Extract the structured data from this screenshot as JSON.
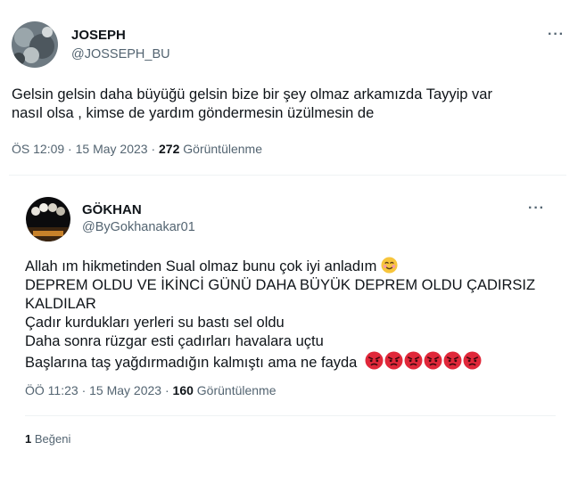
{
  "tweet1": {
    "display_name": "JOSEPH",
    "handle": "@JOSSEPH_BU",
    "more": "···",
    "text_line1": "Gelsin gelsin daha büyüğü gelsin bize bir şey olmaz arkamızda Tayyip var",
    "text_line2": "nasıl olsa , kimse de yardım göndermesin üzülmesin de",
    "time": "ÖS 12:09",
    "dot": "·",
    "date": "15 May 2023",
    "views_count": "272",
    "views_label": "Görüntülenme"
  },
  "tweet2": {
    "display_name": "GÖKHAN",
    "handle": "@ByGokhanakar01",
    "more": "···",
    "line1": "Allah ım hikmetinden Sual olmaz bunu çok iyi anladım",
    "line2": "DEPREM OLDU VE İKİNCİ GÜNÜ DAHA BÜYÜK DEPREM OLDU ÇADIRSIZ",
    "line3": "KALDILAR",
    "line4": "Çadır kurdukları yerleri su bastı sel oldu",
    "line5": "Daha sonra rüzgar esti çadırları havalara uçtu",
    "line6": "Başlarına taş yağdırmadığın kalmıştı ama ne fayda",
    "time": "ÖÖ 11:23",
    "dot": "·",
    "date": "15 May 2023",
    "views_count": "160",
    "views_label": "Görüntülenme",
    "likes_count": "1",
    "likes_label": "Beğeni"
  },
  "icons": {
    "smile": "smiling-face-emoji",
    "angry": "angry-face-emoji"
  },
  "colors": {
    "text": "#0f1419",
    "secondary": "#536471",
    "divider": "#eff3f4",
    "emoji_angry": "#e0283a",
    "emoji_smile": "#f7c53c"
  }
}
